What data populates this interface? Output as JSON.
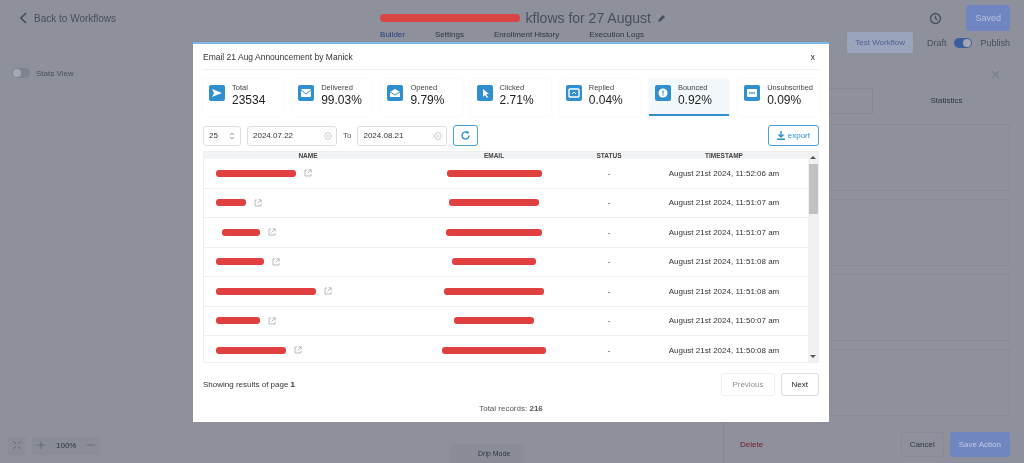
{
  "header": {
    "back_label": "Back to Workflows",
    "title": "kflows for 27 August",
    "saved_button": "Saved"
  },
  "tabs": [
    {
      "label": "Builder",
      "selected": true
    },
    {
      "label": "Settings",
      "selected": false
    },
    {
      "label": "Enrollment History",
      "selected": false
    },
    {
      "label": "Execution Logs",
      "selected": false
    }
  ],
  "actions": {
    "test_button": "Test Workflow",
    "draft_label": "Draft",
    "publish_on": true,
    "publish_label": "Publish"
  },
  "canvas": {
    "stats_view_label": "Stats View",
    "stats_view_on": false,
    "zoom": "100%",
    "drip_mode": "Drip Mode"
  },
  "side_panel": {
    "tab": "Statistics",
    "delete_button": "Delete",
    "cancel_button": "Cancel",
    "save_button": "Save Action"
  },
  "modal": {
    "title": "Email 21 Aug Announcement by Manick",
    "close": "x",
    "stats": [
      {
        "label": "Total",
        "value": "23534",
        "selected": false
      },
      {
        "label": "Delivered",
        "value": "99.03%",
        "selected": false
      },
      {
        "label": "Opened",
        "value": "9.79%",
        "selected": false
      },
      {
        "label": "Clicked",
        "value": "2.71%",
        "selected": false
      },
      {
        "label": "Replied",
        "value": "0.04%",
        "selected": false
      },
      {
        "label": "Bounced",
        "value": "0.92%",
        "selected": true
      },
      {
        "label": "Unsubscribed",
        "value": "0.09%",
        "selected": false
      }
    ],
    "page_size": "25",
    "date_from": "2024.07.22",
    "to_label": "To",
    "date_to": "2024.08.21",
    "export_button": "export",
    "table": {
      "columns": [
        "NAME",
        "EMAIL",
        "STATUS",
        "TIMESTAMP"
      ],
      "rows": [
        {
          "status": "-",
          "timestamp": "August 21st 2024, 11:52:06 am"
        },
        {
          "status": "-",
          "timestamp": "August 21st 2024, 11:51:07 am"
        },
        {
          "status": "-",
          "timestamp": "August 21st 2024, 11:51:07 am"
        },
        {
          "status": "-",
          "timestamp": "August 21st 2024, 11:51:08 am"
        },
        {
          "status": "-",
          "timestamp": "August 21st 2024, 11:51:08 am"
        },
        {
          "status": "-",
          "timestamp": "August 21st 2024, 11:50:07 am"
        },
        {
          "status": "-",
          "timestamp": "August 21st 2024, 11:50:08 am"
        }
      ]
    },
    "page_info": "Showing results of page **1**",
    "previous_button": "Previous",
    "previous_disabled": true,
    "next_button": "Next",
    "total_records": "Total records: **216**"
  }
}
